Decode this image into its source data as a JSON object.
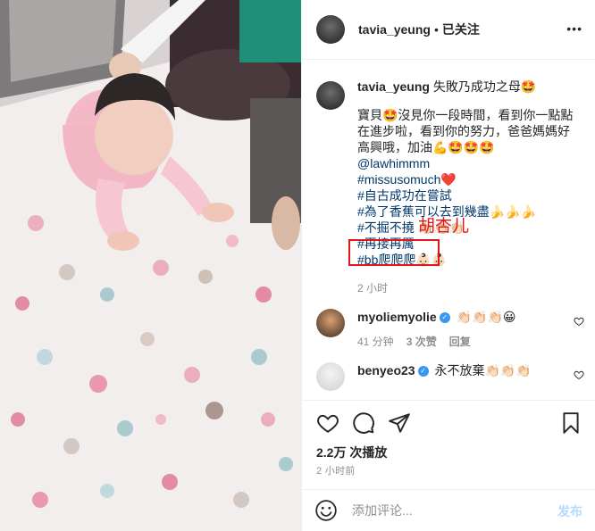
{
  "post": {
    "author": "tavia_yeung",
    "separator": "•",
    "follow_label": "已关注",
    "more_label": "•••"
  },
  "caption": {
    "author": "tavia_yeung",
    "title": "失敗乃成功之母🤩",
    "body": "寶貝🤩沒見你一段時間，看到你一點點在進步啦，看到你的努力，爸爸媽媽好高興哦，加油💪🤩🤩🤩",
    "mention": "@lawhimmm",
    "hashtags": [
      "#missusomuch❤️",
      "#自古成功在嘗試",
      "#為了香蕉可以去到幾盡🍌🍌🍌",
      "#不掘不撓 👏🏻👏🏻👏🏻",
      "#再接再厲",
      "#bb爬爬爬👶🏻👶🏻"
    ],
    "time": "2 小时"
  },
  "annotation": {
    "label": "胡杏儿"
  },
  "comments": [
    {
      "user": "myoliemyolie",
      "verified_mark": "✓",
      "text": "👏🏻👏🏻👏🏻😀",
      "time": "41 分钟",
      "likes": "3 次赞",
      "reply": "回复"
    },
    {
      "user": "benyeo23",
      "verified_mark": "✓",
      "text": "永不放棄👏🏻👏🏻👏🏻"
    }
  ],
  "stats": {
    "views": "2.2万 次播放",
    "posted": "2 小时前"
  },
  "composer": {
    "placeholder": "添加评论...",
    "post_label": "发布"
  },
  "colors": {
    "accent": "#3897f0",
    "annotation": "#e0161b",
    "link": "#00376b",
    "muted": "#8e8e8e"
  }
}
